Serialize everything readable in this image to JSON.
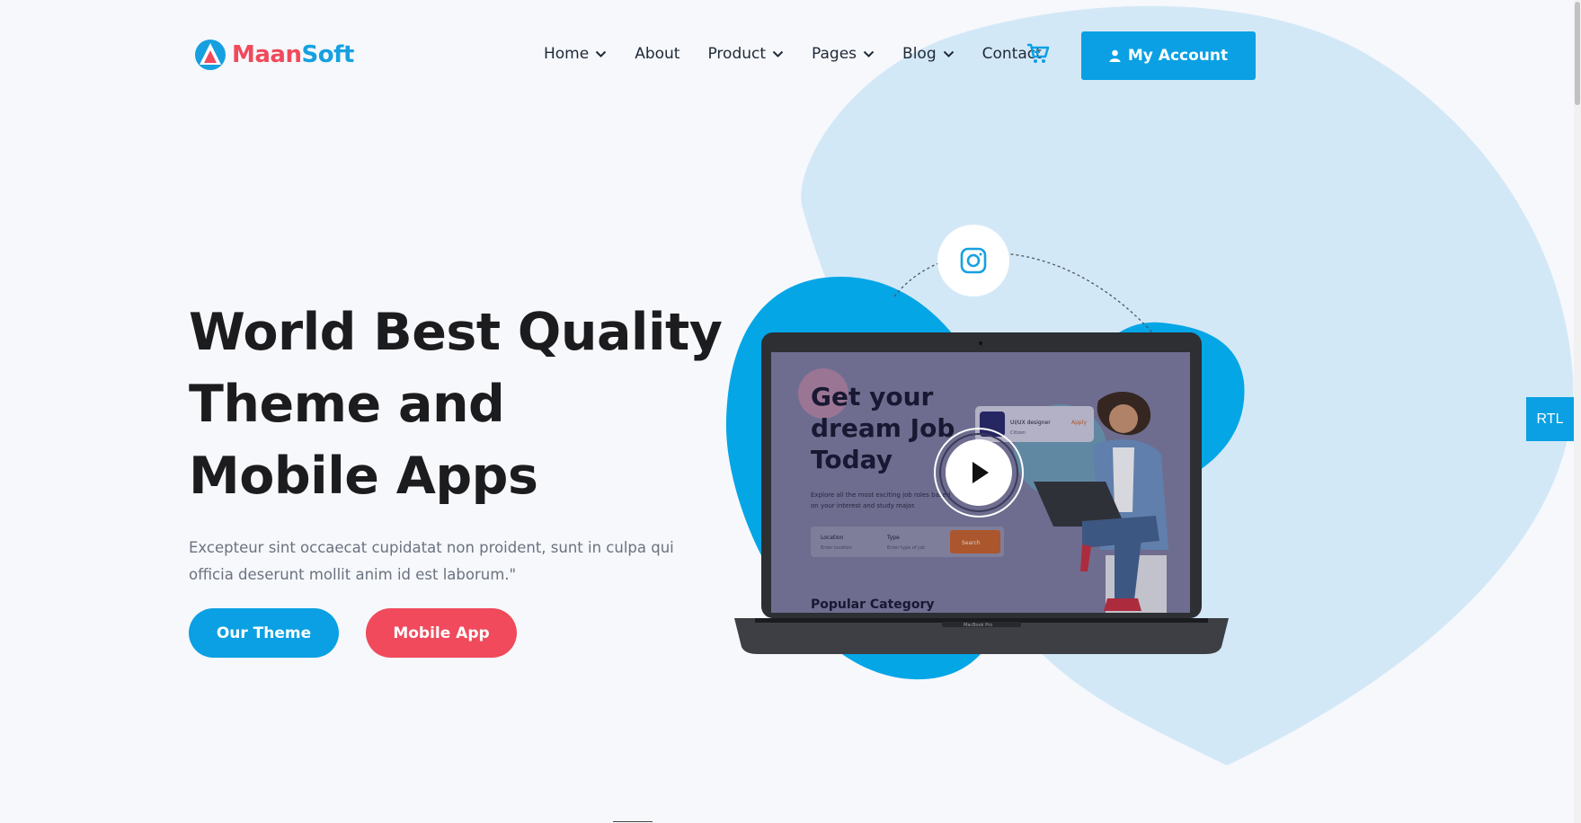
{
  "brand": {
    "name_part1": "Maan",
    "name_part2": "Soft"
  },
  "nav": {
    "items": [
      {
        "label": "Home",
        "dropdown": true
      },
      {
        "label": "About",
        "dropdown": false
      },
      {
        "label": "Product",
        "dropdown": true
      },
      {
        "label": "Pages",
        "dropdown": true
      },
      {
        "label": "Blog",
        "dropdown": true
      },
      {
        "label": "Contact",
        "dropdown": false
      }
    ],
    "account_label": "My Account"
  },
  "hero": {
    "title_line1": "World Best Quality",
    "title_line2": "Theme and",
    "title_line3": "Mobile Apps",
    "description": "Excepteur sint occaecat cupidatat non proident, sunt in culpa qui officia deserunt mollit anim id est laborum.\"",
    "buttons": {
      "primary": "Our Theme",
      "secondary": "Mobile App"
    }
  },
  "screen": {
    "headline_1": "Get your",
    "headline_2": "dream Job",
    "headline_3": "Today",
    "subtext_1": "Explore all the most exciting job roles based",
    "subtext_2": "on your interest and study major.",
    "card_title": "UI/UX designer",
    "card_action": "Apply",
    "card_sub": "Citizen",
    "field_location": "Location",
    "field_location_hint": "Enter location",
    "field_type": "Type",
    "field_type_hint": "Enter type of job",
    "search_label": "Search",
    "category_label": "Popular Category",
    "laptop_model": "MacBook Pro"
  },
  "rtl_label": "RTL",
  "colors": {
    "primary": "#0aa0e3",
    "accent": "#f04a5c",
    "blob_light": "#d3e8f7",
    "blob_dark": "#04a6e6"
  },
  "icons": [
    "chevron-down-icon",
    "cart-icon",
    "user-icon",
    "instagram-icon",
    "play-icon",
    "logo-icon"
  ]
}
